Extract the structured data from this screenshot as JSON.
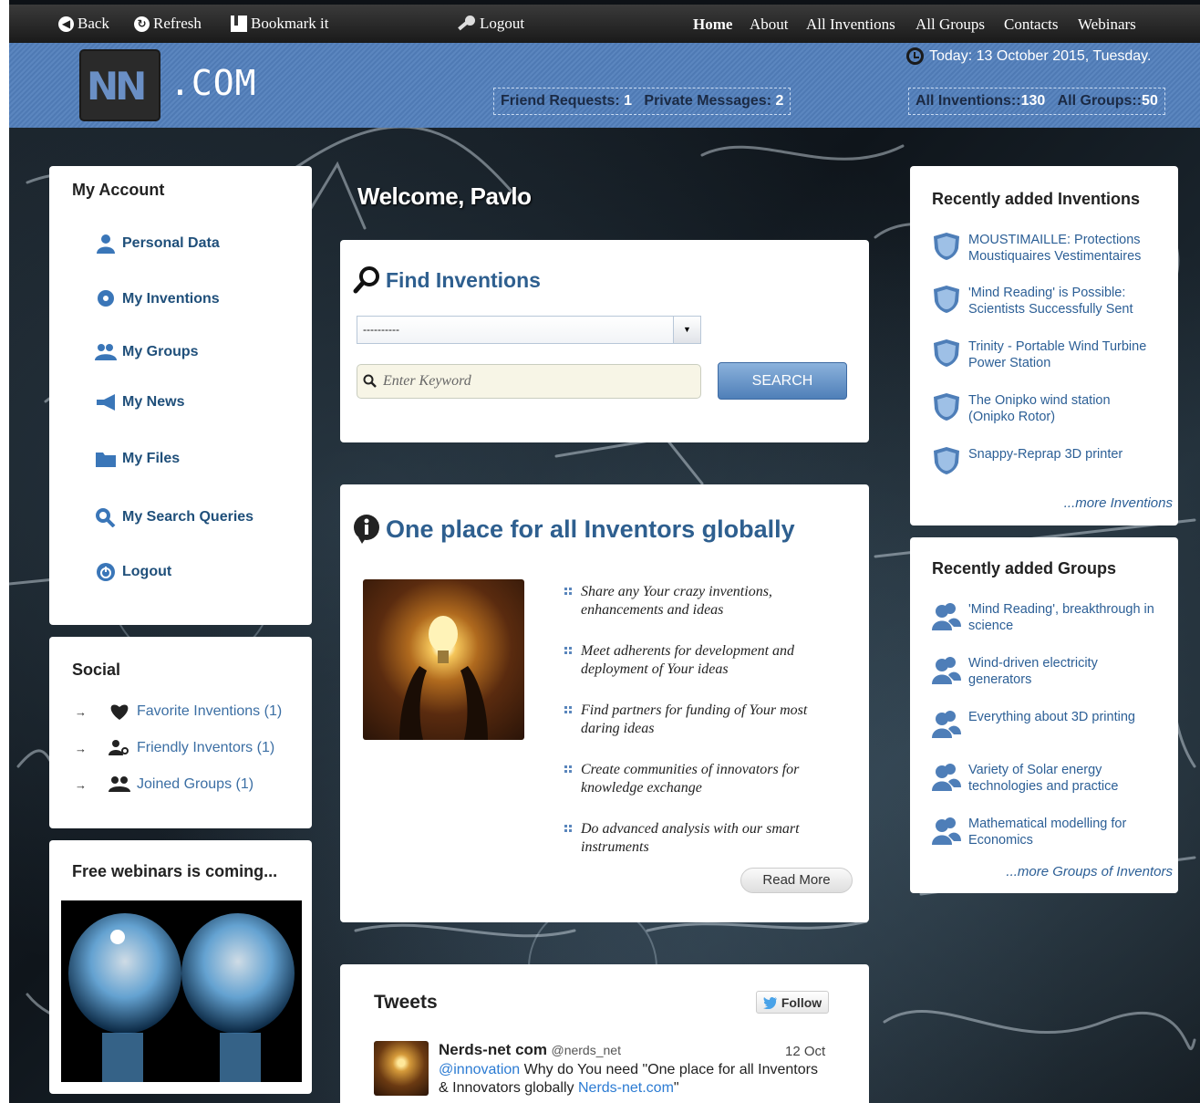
{
  "topnav": {
    "back": "Back",
    "refresh": "Refresh",
    "bookmark": "Bookmark it",
    "logout": "Logout",
    "links": [
      "Home",
      "About",
      "All Inventions",
      "All Groups",
      "Contacts",
      "Webinars"
    ],
    "active": "Home"
  },
  "header": {
    "logo_mark": "NN",
    "logo_suffix": ".COM",
    "today": "Today: 13 October 2015, Tuesday.",
    "friend_requests_label": "Friend Requests:",
    "friend_requests_count": "1",
    "private_messages_label": "Private Messages:",
    "private_messages_count": "2",
    "all_inventions_label": "All Inventions::",
    "all_inventions_count": "130",
    "all_groups_label": "All Groups::",
    "all_groups_count": "50"
  },
  "account": {
    "title": "My Account",
    "items": [
      "Personal Data",
      "My Inventions",
      "My Groups",
      "My News",
      "My Files",
      "My Search Queries",
      "Logout"
    ]
  },
  "social": {
    "title": "Social",
    "items": [
      "Favorite Inventions (1)",
      "Friendly Inventors (1)",
      "Joined Groups (1)"
    ]
  },
  "webinars": {
    "title": "Free webinars is coming..."
  },
  "welcome": "Welcome, Pavlo",
  "find": {
    "title": "Find Inventions",
    "select_value": "----------",
    "keyword_placeholder": "Enter Keyword",
    "search_label": "SEARCH"
  },
  "about": {
    "title": "One place for all Inventors globally",
    "bullets": [
      "Share any Your crazy inventions, enhancements and ideas",
      "Meet adherents for development and deployment of Your ideas",
      "Find partners for funding of Your most daring ideas",
      "Create communities of innovators for knowledge exchange",
      "Do advanced analysis with our smart instruments"
    ],
    "read_more": "Read More"
  },
  "tweets": {
    "title": "Tweets",
    "follow": "Follow",
    "name": "Nerds-net com",
    "handle": "@nerds_net",
    "date": "12 Oct",
    "mention": "@innovation",
    "text_mid": " Why do You need \"One place for all Inventors & Innovators globally ",
    "link": "Nerds-net.com",
    "text_end": "\""
  },
  "recent_inventions": {
    "title": "Recently added Inventions",
    "items": [
      "MOUSTIMAILLE: Protections Moustiquaires Vestimentaires",
      "'Mind Reading' is Possible: Scientists Successfully Sent",
      "Trinity - Portable Wind Turbine Power Station",
      "The Onipko wind station (Onipko Rotor)",
      "Snappy-Reprap 3D printer"
    ],
    "more": "...more Inventions"
  },
  "recent_groups": {
    "title": "Recently added Groups",
    "items": [
      "'Mind Reading', breakthrough in science",
      "Wind-driven electricity generators",
      "Everything about 3D printing",
      "Variety of Solar energy technologies and practice",
      "Mathematical modelling for Economics"
    ],
    "more": "...more Groups of Inventors"
  },
  "colors": {
    "header_blue": "#5b86bf",
    "link_blue": "#2c5f96",
    "title_blue": "#2e5f8f"
  }
}
